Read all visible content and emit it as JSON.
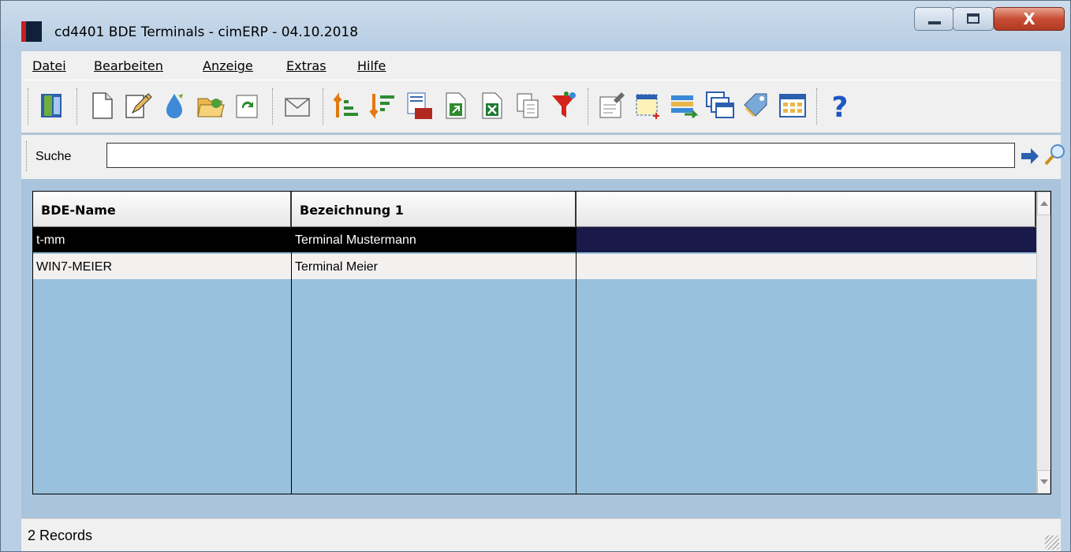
{
  "window": {
    "title": "cd4401 BDE Terminals - cimERP - 04.10.2018",
    "close_label": "X"
  },
  "menu": {
    "items": [
      "Datei",
      "Bearbeiten",
      "Anzeige",
      "Extras",
      "Hilfe"
    ]
  },
  "toolbar": {
    "icons": [
      "exit-door-icon",
      "new-document-icon",
      "edit-pencil-icon",
      "water-drop-icon",
      "folder-open-icon",
      "refresh-icon",
      "mail-envelope-icon",
      "sort-ascending-icon",
      "sort-descending-icon",
      "number-format-icon",
      "export-icon",
      "excel-export-icon",
      "copy-icon",
      "filter-funnel-icon",
      "form-note-icon",
      "select-area-icon",
      "list-arrow-icon",
      "windows-cascade-icon",
      "tag-label-icon",
      "grid-view-icon",
      "help-icon"
    ]
  },
  "search": {
    "label": "Suche",
    "value": "",
    "placeholder": ""
  },
  "grid": {
    "columns": [
      "BDE-Name",
      "Bezeichnung 1",
      ""
    ],
    "rows": [
      {
        "bde_name": "t-mm",
        "bezeichnung1": "Terminal Mustermann",
        "selected": true
      },
      {
        "bde_name": "WIN7-MEIER",
        "bezeichnung1": "Terminal Meier",
        "selected": false
      }
    ]
  },
  "status": {
    "text": "2 Records"
  },
  "colors": {
    "selected_row": "#000000",
    "selected_row_extra": "#1a1a4a",
    "grid_background": "#99c0dc",
    "frame": "#a9c4dc"
  }
}
